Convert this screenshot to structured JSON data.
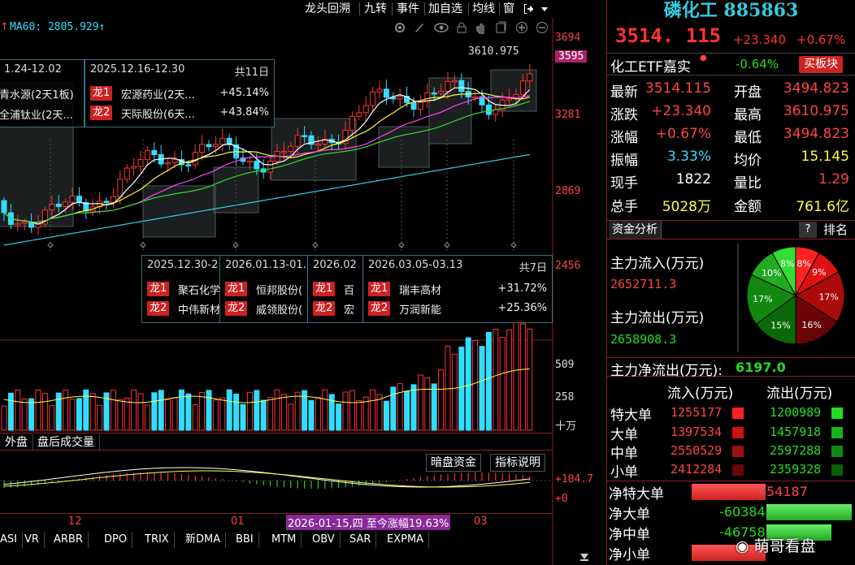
{
  "menu": {
    "items": [
      "龙头回溯",
      "九转",
      "事件",
      "加自选",
      "均线",
      "窗"
    ],
    "overflow_icon": "exit-arrow-icon",
    "dropdown_icon": "caret-down-icon"
  },
  "chart": {
    "ma_label": "MA60: 2805.929↑",
    "ma_left_arrow": "↑",
    "price_axis": [
      "3694",
      "3595",
      "3281",
      "2869",
      "2456"
    ],
    "max_price_note": "3610.975",
    "toolbar_icons": [
      "gear-icon",
      "brush-icon",
      "eye-icon",
      "lock-icon",
      "hand-icon",
      "copy-icon",
      "zoom-in-icon",
      "zoom-out-icon"
    ],
    "popups": [
      {
        "range": "1.24-12.02",
        "rows": [
          {
            "tag": "",
            "name": "青水源(2天1板)",
            "pct": ""
          },
          {
            "tag": "",
            "name": "全浦钛业(2天...",
            "pct": ""
          }
        ]
      },
      {
        "range": "2025.12.16-12.30",
        "count": "共11日",
        "rows": [
          {
            "tag": "龙1",
            "name": "宏源药业(2天...",
            "pct": "+45.14%"
          },
          {
            "tag": "龙2",
            "name": "天际股份(6天...",
            "pct": "+43.84%"
          }
        ]
      },
      {
        "range": "2025.12.30-2",
        "rows": [
          {
            "tag": "龙1",
            "name": "聚石化学"
          },
          {
            "tag": "龙2",
            "name": "中伟新材"
          }
        ]
      },
      {
        "range": "2026.01.13-01.",
        "rows": [
          {
            "tag": "龙1",
            "name": "恒邦股份("
          },
          {
            "tag": "龙2",
            "name": "威领股份("
          }
        ]
      },
      {
        "range": "2026.02",
        "rows": [
          {
            "tag": "龙1",
            "name": "百"
          },
          {
            "tag": "龙2",
            "name": "宏"
          }
        ]
      },
      {
        "range": "2026.03.05-03.13",
        "count": "共7日",
        "rows": [
          {
            "tag": "龙1",
            "name": "瑞丰高材",
            "pct": "+31.72%"
          },
          {
            "tag": "龙2",
            "name": "万润新能",
            "pct": "+25.36%"
          }
        ]
      }
    ],
    "volume_axis": [
      "509",
      "258",
      "十万"
    ],
    "volume_tabs": [
      "外盘",
      "盘后成交量"
    ],
    "indicator_buttons": [
      "暗盘资金",
      "指标说明"
    ],
    "indicator_axis": [
      "+104.7",
      "+0"
    ],
    "date_axis": [
      "12",
      "01",
      "03"
    ],
    "date_tip": "2026-01-15,四 至今涨幅19.63%",
    "indicator_tabs": [
      "ASI",
      "VR",
      "ARBR",
      "DPO",
      "TRIX",
      "新DMA",
      "BBI",
      "MTM",
      "OBV",
      "SAR",
      "EXPMA"
    ]
  },
  "quote": {
    "name": "磷化工",
    "code": "885863",
    "price": "3514. 115",
    "change": "+23.340",
    "change_pct": "+0.67%",
    "etf_name": "化工ETF嘉实",
    "etf_pct": "-0.64%",
    "plate_button": "买板块",
    "rows": [
      {
        "l1": "最新",
        "v1": "3514.115",
        "c1": "red",
        "l2": "开盘",
        "v2": "3494.823",
        "c2": "red"
      },
      {
        "l1": "涨跌",
        "v1": "+23.340",
        "c1": "red",
        "l2": "最高",
        "v2": "3610.975",
        "c2": "red"
      },
      {
        "l1": "涨幅",
        "v1": "+0.67%",
        "c1": "red",
        "l2": "最低",
        "v2": "3494.823",
        "c2": "red"
      },
      {
        "l1": "振幅",
        "v1": "3.33%",
        "c1": "cyn",
        "l2": "均价",
        "v2": "15.145",
        "c2": "yel"
      },
      {
        "l1": "现手",
        "v1": "1822",
        "c1": "wht",
        "l2": "量比",
        "v2": "1.29",
        "c2": "red"
      },
      {
        "l1": "总手",
        "v1": "5028万",
        "c1": "yel",
        "l2": "金额",
        "v2": "761.6亿",
        "c2": "yel"
      }
    ]
  },
  "funds": {
    "tab": "资金分析",
    "help": "?",
    "rank": "排名",
    "inflow_label": "主力流入(万元)",
    "inflow_value": "2652711.3",
    "outflow_label": "主力流出(万元)",
    "outflow_value": "2658908.3",
    "net_label": "主力净流出(万元):",
    "net_value": "6197.0",
    "pie": [
      {
        "pct": "8%",
        "value": 8,
        "color": "#ff2222"
      },
      {
        "pct": "9%",
        "value": 9,
        "color": "#dd1111"
      },
      {
        "pct": "17%",
        "value": 17,
        "color": "#aa0a0a"
      },
      {
        "pct": "16%",
        "value": 16,
        "color": "#6a0505"
      },
      {
        "pct": "15%",
        "value": 15,
        "color": "#0a6a0a"
      },
      {
        "pct": "17%",
        "value": 17,
        "color": "#118811"
      },
      {
        "pct": "10%",
        "value": 10,
        "color": "#22aa22"
      },
      {
        "pct": "8%",
        "value": 8,
        "color": "#33dd33"
      }
    ],
    "col_in": "流入(万元)",
    "col_out": "流出(万元)",
    "rows": [
      {
        "label": "特大单",
        "in": "1255177",
        "out": "1200989",
        "sq_in": "#ff2222",
        "sq_out": "#22dd22"
      },
      {
        "label": "大单",
        "in": "1397534",
        "out": "1457918",
        "sq_in": "#cc1111",
        "sq_out": "#18b018"
      },
      {
        "label": "中单",
        "in": "2550529",
        "out": "2597288",
        "sq_in": "#991111",
        "sq_out": "#118811"
      },
      {
        "label": "小单",
        "in": "2412284",
        "out": "2359328",
        "sq_in": "#660808",
        "sq_out": "#0a600a"
      }
    ],
    "net": [
      {
        "label": "净特大单",
        "value": "54187",
        "positive": true,
        "magnitude": 0.48
      },
      {
        "label": "净大单",
        "value": "-60384",
        "positive": false,
        "magnitude": 0.55
      },
      {
        "label": "净中单",
        "value": "-46758",
        "positive": false,
        "magnitude": 0.42
      },
      {
        "label": "净小单",
        "value": "",
        "positive": true,
        "magnitude": 0.48
      }
    ]
  },
  "watermark": "萌哥看盘"
}
